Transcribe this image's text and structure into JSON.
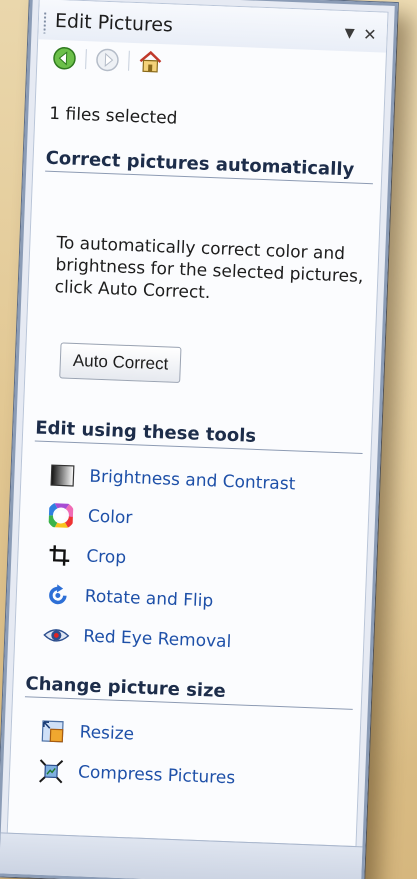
{
  "pane": {
    "title": "Edit Pictures",
    "dropdown_icon": "triangle-down-icon",
    "close_icon": "close-x-icon"
  },
  "nav": {
    "back_icon": "back-arrow-green-icon",
    "forward_icon": "forward-arrow-disabled-icon",
    "home_icon": "home-icon"
  },
  "status": "1 files selected",
  "auto_section": {
    "heading": "Correct pictures automatically",
    "description": "To automatically correct color and brightness for the selected pictures, click Auto Correct.",
    "button_label": "Auto Correct"
  },
  "tools_section": {
    "heading": "Edit using these tools",
    "items": [
      {
        "label": "Brightness and Contrast",
        "icon": "brightness-contrast-icon"
      },
      {
        "label": "Color",
        "icon": "color-wheel-icon"
      },
      {
        "label": "Crop",
        "icon": "crop-icon"
      },
      {
        "label": "Rotate and Flip",
        "icon": "rotate-flip-icon"
      },
      {
        "label": "Red Eye Removal",
        "icon": "red-eye-icon"
      }
    ]
  },
  "size_section": {
    "heading": "Change picture size",
    "items": [
      {
        "label": "Resize",
        "icon": "resize-icon"
      },
      {
        "label": "Compress Pictures",
        "icon": "compress-pictures-icon"
      }
    ]
  },
  "colors": {
    "link": "#1e50a8",
    "heading": "#1d2d4a",
    "background": "#e2c894"
  }
}
